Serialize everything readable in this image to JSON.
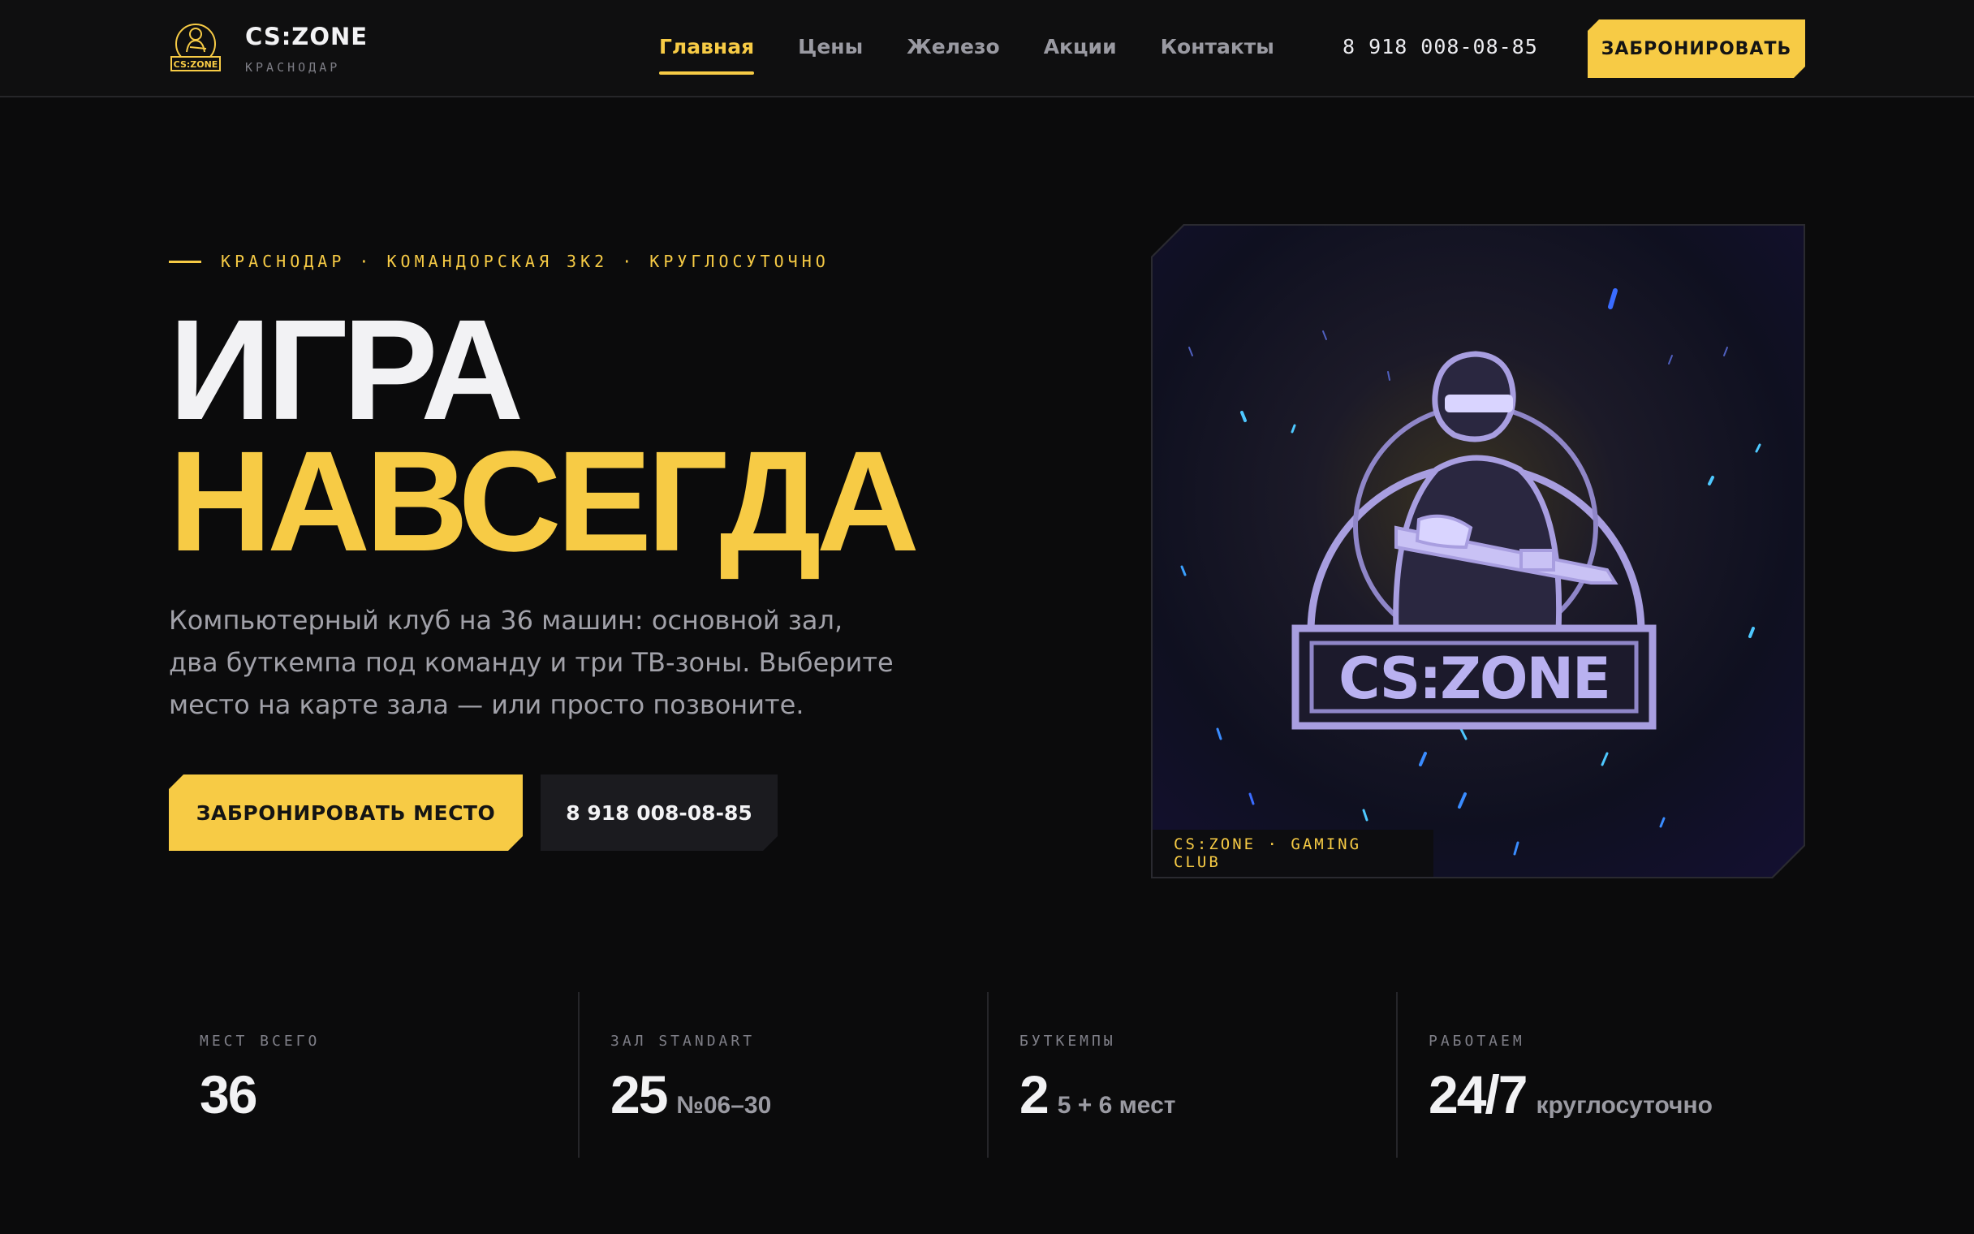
{
  "header": {
    "brand_name": "CS:ZONE",
    "brand_city": "КРАСНОДАР",
    "logo_icon": "soldier-logo-icon",
    "nav": [
      {
        "label": "Главная",
        "active": true
      },
      {
        "label": "Цены",
        "active": false
      },
      {
        "label": "Железо",
        "active": false
      },
      {
        "label": "Акции",
        "active": false
      },
      {
        "label": "Контакты",
        "active": false
      }
    ],
    "phone": "8 918 008-08-85",
    "cta_label": "ЗАБРОНИРОВАТЬ"
  },
  "hero": {
    "eyebrow": "КРАСНОДАР · КОМАНДОРСКАЯ 3К2 · КРУГЛОСУТОЧНО",
    "headline_line1": "ИГРА",
    "headline_line2": "НАВСЕГДА",
    "description": "Компьютерный клуб на 36 машин: основной зал, два буткемпа под команду и три ТВ-зоны. Выберите место на карте зала — или просто позвоните.",
    "primary_button": "ЗАБРОНИРОВАТЬ МЕСТО",
    "secondary_button": "8 918 008-08-85",
    "image_logo_text": "CS:ZONE",
    "image_caption": "CS:ZONE · GAMING CLUB"
  },
  "stats": [
    {
      "label": "МЕСТ ВСЕГО",
      "value": "36",
      "sub": ""
    },
    {
      "label": "ЗАЛ STANDART",
      "value": "25",
      "sub": "№06–30"
    },
    {
      "label": "БУТКЕМПЫ",
      "value": "2",
      "sub": "5 + 6 мест"
    },
    {
      "label": "РАБОТАЕМ",
      "value": "24/7",
      "sub": "круглосуточно"
    }
  ],
  "colors": {
    "accent": "#f7cb45",
    "background": "#0b0b0c",
    "text": "#f2f2f4",
    "muted": "#9a9aa2"
  }
}
